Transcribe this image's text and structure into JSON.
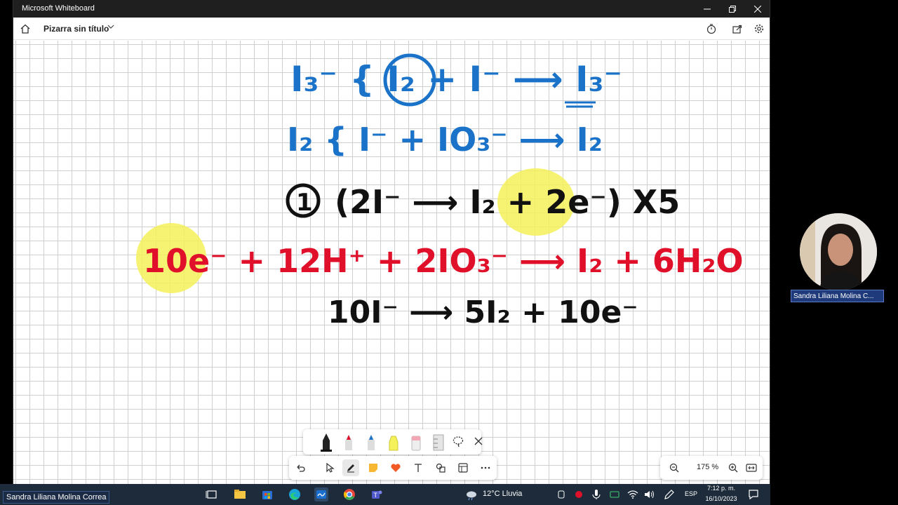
{
  "window": {
    "app_title": "Microsoft Whiteboard",
    "doc_title": "Pizarra sin título",
    "zoom": "175 %"
  },
  "ink": {
    "line1": "I₃⁻ {  I₂ + I⁻ ⟶ I₃⁻",
    "line2": "I₂ { I⁻ + IO₃⁻ ⟶ I₂",
    "line3_num": "1",
    "line3": "(2I⁻ ⟶ I₂ + 2e⁻) X5",
    "line4": "10e⁻ + 12H⁺ + 2IO₃⁻ ⟶ I₂ + 6H₂O",
    "line5": "10I⁻ ⟶ 5I₂ + 10e⁻"
  },
  "colors": {
    "blue": "#1a73c8",
    "red": "#e0102a",
    "black": "#111111",
    "highlight": "#f5f15a",
    "taskbar": "#1d2b3a"
  },
  "participant": {
    "name": "Sandra Liliana Molina C..."
  },
  "taskbar": {
    "weather": "12°C  Lluvia",
    "lang": "ESP",
    "time": "7:12 p. m.",
    "date": "16/10/2023",
    "caller": "Sandra Liliana Molina Correa"
  }
}
